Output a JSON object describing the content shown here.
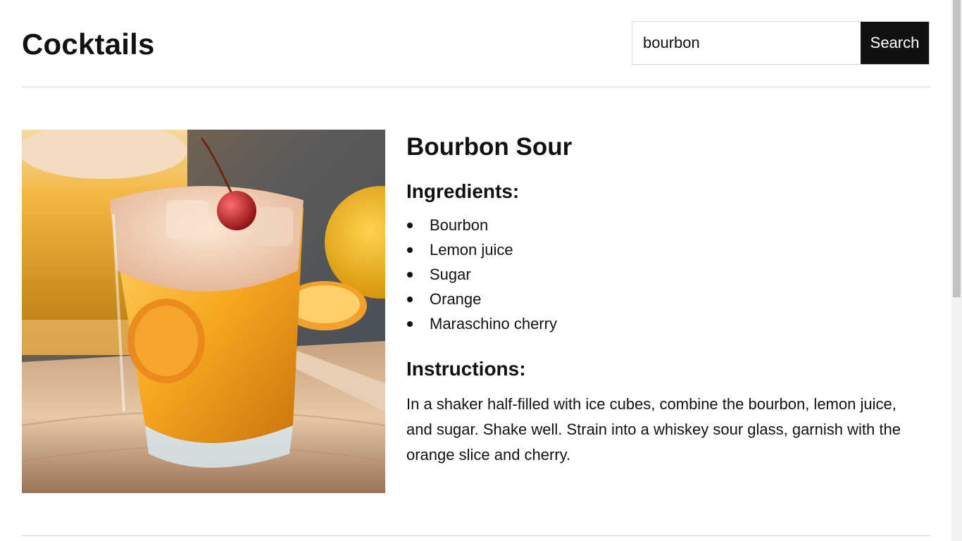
{
  "header": {
    "title": "Cocktails",
    "search": {
      "value": "bourbon",
      "button_label": "Search"
    }
  },
  "cocktail": {
    "name": "Bourbon Sour",
    "image_alt": "Bourbon Sour",
    "ingredients_heading": "Ingredients:",
    "ingredients": [
      "Bourbon",
      "Lemon juice",
      "Sugar",
      "Orange",
      "Maraschino cherry"
    ],
    "instructions_heading": "Instructions:",
    "instructions": "In a shaker half-filled with ice cubes, combine the bourbon, lemon juice, and sugar. Shake well. Strain into a whiskey sour glass, garnish with the orange slice and cherry."
  },
  "colors": {
    "text": "#111111",
    "button_bg": "#111111",
    "button_text": "#ffffff",
    "divider": "#d9d9d9"
  }
}
